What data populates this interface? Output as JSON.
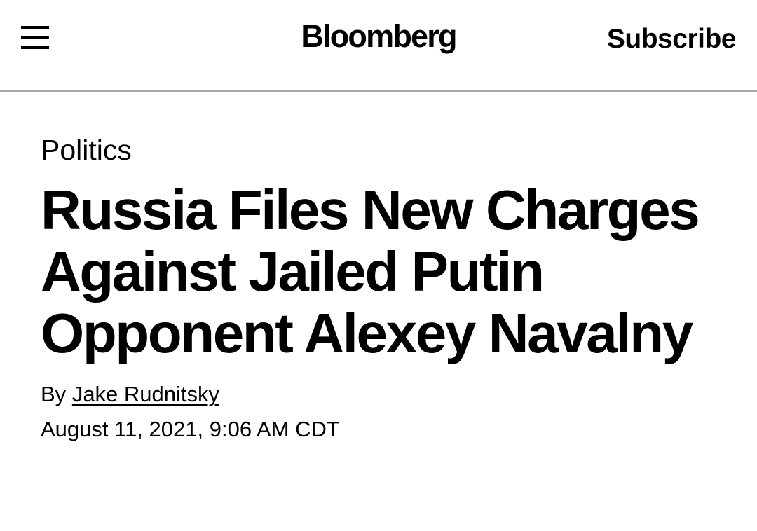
{
  "header": {
    "logo": "Bloomberg",
    "subscribe_label": "Subscribe",
    "menu_icon": "hamburger-menu-icon"
  },
  "article": {
    "category": "Politics",
    "headline": "Russia Files New Charges Against Jailed Putin Opponent Alexey Navalny",
    "byline_prefix": "By",
    "author": "Jake Rudnitsky",
    "date": "August 11, 2021, 9:06 AM CDT"
  },
  "colors": {
    "text": "#000000",
    "background": "#ffffff",
    "divider": "#a8a8a8"
  }
}
